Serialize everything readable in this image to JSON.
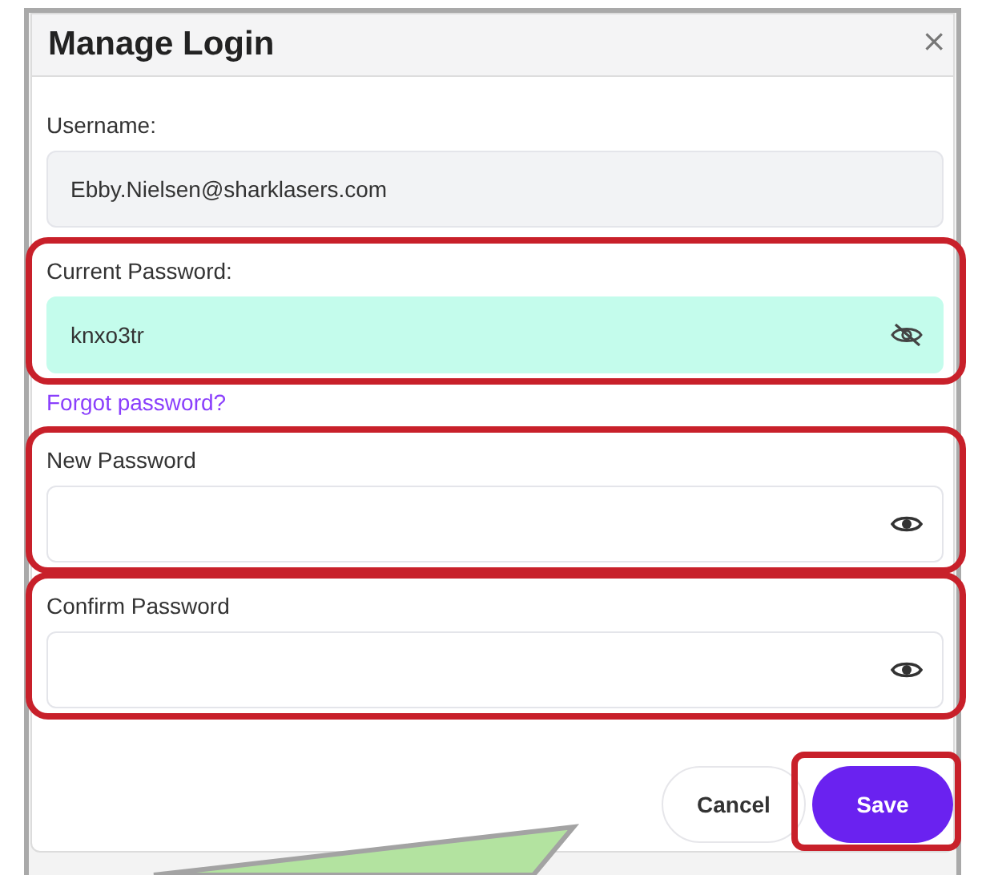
{
  "dialog": {
    "title": "Manage Login",
    "close": "×"
  },
  "items": [
    {
      "kind": "field",
      "label": "Username:",
      "value": "Ebby.Nielsen@sharklasers.com",
      "readonly": true,
      "autofilled": false,
      "password": false,
      "annotated": false
    },
    {
      "kind": "field",
      "label": "Current Password:",
      "value": "knxo3tr",
      "readonly": false,
      "autofilled": true,
      "password": true,
      "revealed": true,
      "annotated": true
    },
    {
      "kind": "link",
      "text": "Forgot password?"
    },
    {
      "kind": "field",
      "label": "New Password",
      "value": "",
      "readonly": false,
      "autofilled": false,
      "password": true,
      "revealed": false,
      "annotated": true
    },
    {
      "kind": "field",
      "label": "Confirm Password",
      "value": "",
      "readonly": false,
      "autofilled": false,
      "password": true,
      "revealed": false,
      "annotated": true
    }
  ],
  "buttons": [
    {
      "label": "Cancel",
      "primary": false,
      "annotated": false
    },
    {
      "label": "Save",
      "primary": true,
      "annotated": true
    }
  ]
}
